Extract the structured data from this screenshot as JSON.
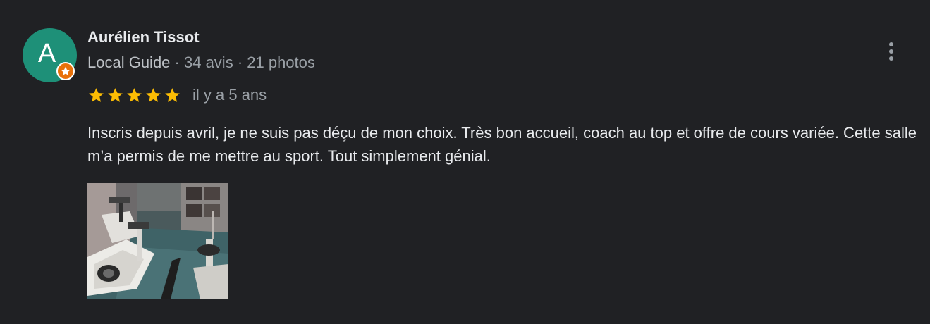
{
  "review": {
    "author": {
      "initial": "A",
      "name": "Aurélien Tissot",
      "badge_icon": "local-guide-star-icon",
      "avatar_color": "#1e9078",
      "badge_color": "#e8710a",
      "meta": {
        "level": "Local Guide",
        "separator": " · ",
        "reviews": "34 avis",
        "photos": "21 photos"
      }
    },
    "rating": {
      "value": 5,
      "max": 5,
      "star_color": "#fbbc04"
    },
    "time": "il y a 5 ans",
    "text": "Inscris depuis avril, je ne suis pas déçu de mon choix. Très bon accueil, coach au top et offre de cours variée. Cette salle m’a permis de me mettre au sport. Tout simplement génial.",
    "photos": [
      {
        "subject": "gym-spin-bikes-photo"
      }
    ],
    "more_icon": "more-vert-icon"
  }
}
